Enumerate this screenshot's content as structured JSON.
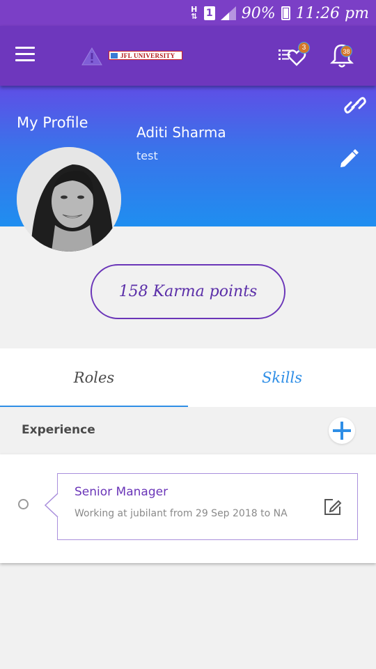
{
  "status_bar": {
    "network": "H",
    "sim": "1",
    "battery": "90%",
    "time": "11:26 pm"
  },
  "app_bar": {
    "logo_text": "JFL UNIVERSITY",
    "wishlist_badge": "3",
    "notifications_badge": "38"
  },
  "profile": {
    "section_title": "My Profile",
    "name": "Aditi Sharma",
    "subtitle": "test"
  },
  "karma": {
    "label": "158 Karma points"
  },
  "tabs": [
    {
      "label": "Roles",
      "active": true
    },
    {
      "label": "Skills",
      "active": false
    }
  ],
  "experience": {
    "heading": "Experience",
    "items": [
      {
        "title": "Senior Manager",
        "description": "Working at jubilant from 29 Sep 2018 to NA"
      }
    ]
  },
  "colors": {
    "app_bar": "#6e37bd",
    "status_bar": "#7b3fc6",
    "accent_blue": "#2e8ee6",
    "accent_purple": "#6a35b8"
  },
  "icons": {
    "menu": "hamburger-menu-icon",
    "warning": "warning-icon",
    "wishlist": "heart-list-icon",
    "notifications": "bell-icon",
    "link": "link-icon",
    "edit": "pencil-icon",
    "add": "plus-icon",
    "edit_experience": "edit-square-icon"
  }
}
